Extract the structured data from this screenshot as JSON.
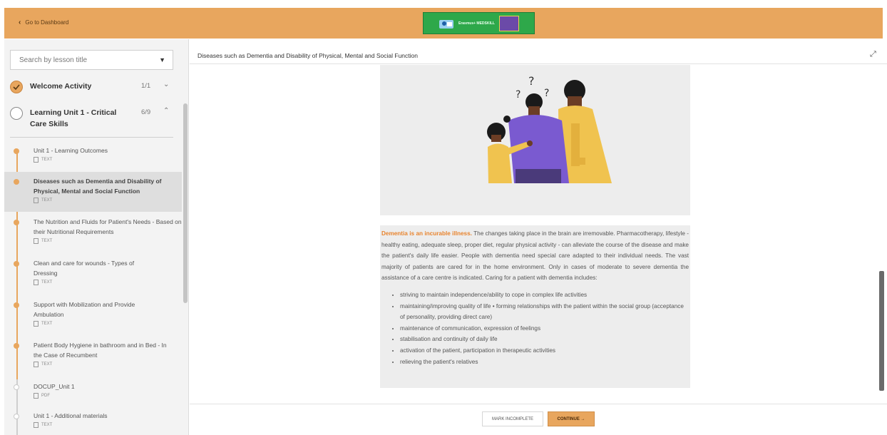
{
  "topbar": {
    "back_label": "Go to Dashboard",
    "banner_text": "Erasmus+ MEDSKILL"
  },
  "sidebar": {
    "search_placeholder": "Search by lesson title",
    "modules": [
      {
        "title": "Welcome Activity",
        "count": "1/1",
        "completed": true
      },
      {
        "title": "Learning Unit 1 - Critical Care Skills",
        "count": "6/9",
        "completed": false
      }
    ],
    "lessons": [
      {
        "title": "Unit 1 - Learning Outcomes",
        "type": "TEXT",
        "done": true
      },
      {
        "title": "Diseases such as Dementia and Disability of Physical, Mental and Social Function",
        "type": "TEXT",
        "done": true,
        "active": true
      },
      {
        "title": "The Nutrition and Fluids for Patient's Needs - Based on their Nutritional Requirements",
        "type": "TEXT",
        "done": true
      },
      {
        "title": "Clean and care for wounds - Types of Dressing",
        "type": "TEXT",
        "done": true
      },
      {
        "title": "Support with Mobilization and Provide Ambulation",
        "type": "TEXT",
        "done": true
      },
      {
        "title": "Patient Body Hygiene in bathroom and in Bed - In the Case of Recumbent",
        "type": "TEXT",
        "done": true
      },
      {
        "title": "DOCUP_Unit 1",
        "type": "PDF",
        "done": false
      },
      {
        "title": "Unit 1 - Additional materials",
        "type": "TEXT",
        "done": false
      }
    ]
  },
  "main": {
    "lesson_title": "Diseases such as Dementia and Disability of Physical, Mental and Social Function",
    "highlight": "Dementia is an incurable illness.",
    "paragraph": " The changes taking place in the brain are irremovable. Pharmacotherapy, lifestyle - healthy eating, adequate sleep, proper diet, regular physical activity - can alleviate the course of the disease and make the patient's daily life easier. People with dementia need special care adapted to their individual needs. The vast majority of patients are cared for in the home environment. Only in cases of moderate to severe dementia the assistance of a care centre is indicated. Caring for a patient with dementia includes:",
    "bullets": [
      "striving to maintain independence/ability to cope in complex life activities",
      "maintaining/improving quality of life • forming relationships with the patient within the social group (acceptance of personality, providing direct care)",
      "maintenance of communication, expression of feelings",
      "stabilisation and continuity of daily life",
      "activation of the patient, participation in therapeutic activities",
      "relieving the patient's relatives"
    ]
  },
  "footer": {
    "mark_incomplete_label": "MARK INCOMPLETE",
    "continue_label": "CONTINUE →"
  },
  "colors": {
    "accent": "#e8a65e",
    "highlight_text": "#e8842e",
    "banner_green": "#2ea84a"
  }
}
